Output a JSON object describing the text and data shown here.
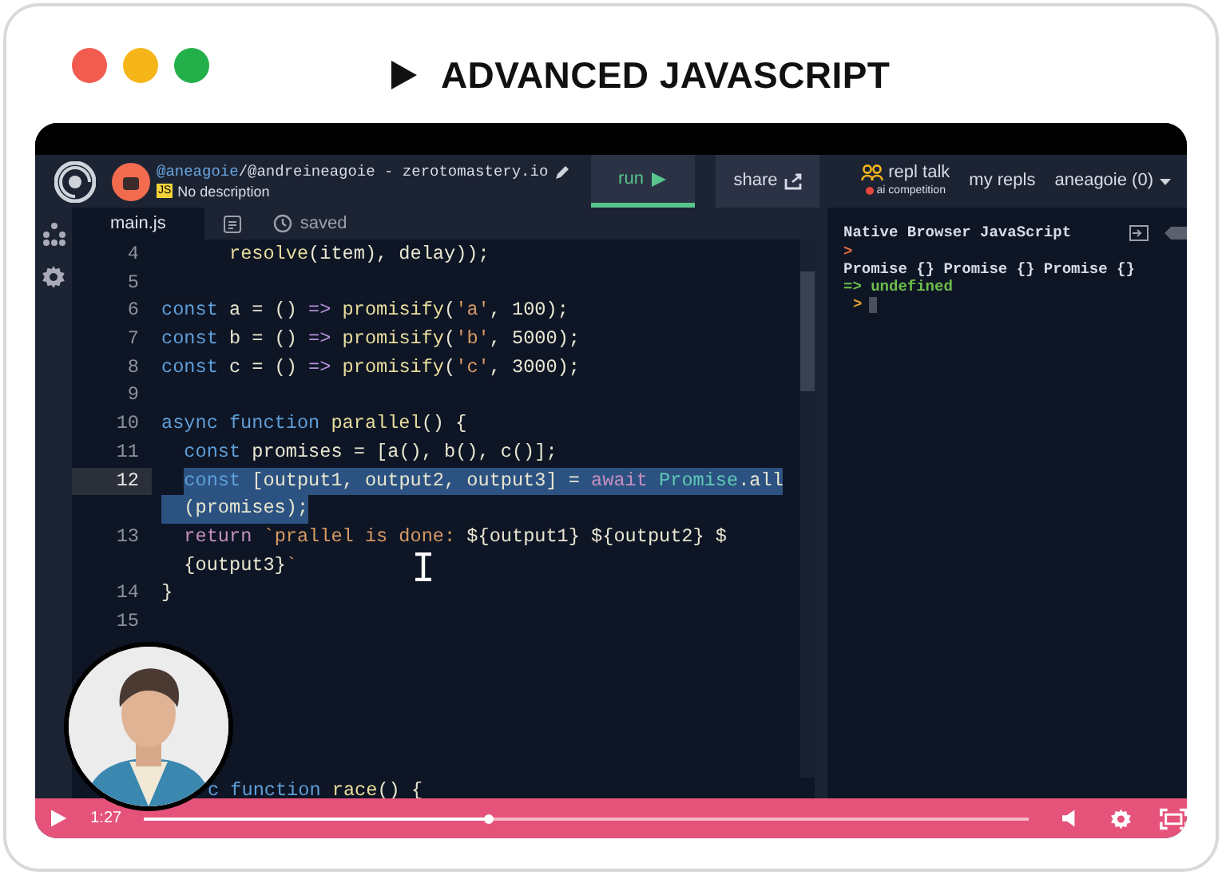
{
  "title": "ADVANCED JAVASCRIPT",
  "repl": {
    "owner": "@aneagoie",
    "name": "/@andreineagoie - zerotomastery.io",
    "badge": "JS",
    "description": "No description",
    "actions": [
      {
        "label": "run",
        "selected": true,
        "kind": "run"
      },
      {
        "label": "share",
        "selected": false,
        "kind": "share"
      }
    ],
    "talk": {
      "label": "repl talk",
      "sub": "ai competition"
    },
    "links": [
      "my repls"
    ],
    "user": "aneagoie (0)"
  },
  "editor": {
    "tab": "main.js",
    "status": "saved",
    "rows": [
      {
        "kind": "code",
        "number": "4",
        "current": false,
        "selected": false,
        "indent": "      ",
        "tokens": [
          {
            "text": "resolve",
            "kind": "func"
          },
          {
            "text": "(item), delay));",
            "kind": "plain"
          }
        ]
      },
      {
        "kind": "code",
        "number": "5",
        "current": false,
        "selected": false,
        "indent": "",
        "tokens": []
      },
      {
        "kind": "code",
        "number": "6",
        "current": false,
        "selected": false,
        "indent": "",
        "tokens": [
          {
            "text": "const",
            "kind": "decl"
          },
          {
            "text": " a = () ",
            "kind": "plain"
          },
          {
            "text": "=>",
            "kind": "operator"
          },
          {
            "text": " promisify",
            "kind": "func"
          },
          {
            "text": "(",
            "kind": "plain"
          },
          {
            "text": "'a'",
            "kind": "string"
          },
          {
            "text": ", 100);",
            "kind": "plain"
          }
        ]
      },
      {
        "kind": "code",
        "number": "7",
        "current": false,
        "selected": false,
        "indent": "",
        "tokens": [
          {
            "text": "const",
            "kind": "decl"
          },
          {
            "text": " b = () ",
            "kind": "plain"
          },
          {
            "text": "=>",
            "kind": "operator"
          },
          {
            "text": " promisify",
            "kind": "func"
          },
          {
            "text": "(",
            "kind": "plain"
          },
          {
            "text": "'b'",
            "kind": "string"
          },
          {
            "text": ", 5000);",
            "kind": "plain"
          }
        ]
      },
      {
        "kind": "code",
        "number": "8",
        "current": false,
        "selected": false,
        "indent": "",
        "tokens": [
          {
            "text": "const",
            "kind": "decl"
          },
          {
            "text": " c = () ",
            "kind": "plain"
          },
          {
            "text": "=>",
            "kind": "operator"
          },
          {
            "text": " promisify",
            "kind": "func"
          },
          {
            "text": "(",
            "kind": "plain"
          },
          {
            "text": "'c'",
            "kind": "string"
          },
          {
            "text": ", 3000);",
            "kind": "plain"
          }
        ]
      },
      {
        "kind": "code",
        "number": "9",
        "current": false,
        "selected": false,
        "indent": "",
        "tokens": []
      },
      {
        "kind": "code",
        "number": "10",
        "current": false,
        "selected": false,
        "indent": "",
        "tokens": [
          {
            "text": "async function",
            "kind": "decl"
          },
          {
            "text": " parallel",
            "kind": "func"
          },
          {
            "text": "() {",
            "kind": "plain"
          }
        ]
      },
      {
        "kind": "code",
        "number": "11",
        "current": false,
        "selected": false,
        "indent": "  ",
        "tokens": [
          {
            "text": "const",
            "kind": "decl"
          },
          {
            "text": " promises = [a(), b(), c()];",
            "kind": "plain"
          }
        ]
      },
      {
        "kind": "code",
        "number": "12",
        "current": true,
        "selected": true,
        "indent": "  ",
        "tokens": [
          {
            "text": "const",
            "kind": "decl"
          },
          {
            "text": " [output1, output2, output3] = ",
            "kind": "plain"
          },
          {
            "text": "await",
            "kind": "control"
          },
          {
            "text": " Promise",
            "kind": "class"
          },
          {
            "text": ".all",
            "kind": "plain"
          }
        ]
      },
      {
        "kind": "code",
        "current": false,
        "selected": true,
        "indent": "",
        "tokens": [
          {
            "text": "  (promises);",
            "kind": "plain"
          }
        ]
      },
      {
        "kind": "code",
        "number": "13",
        "current": false,
        "selected": false,
        "indent": "  ",
        "tokens": [
          {
            "text": "return",
            "kind": "control"
          },
          {
            "text": " `prallel is done: ",
            "kind": "string"
          },
          {
            "text": "${output1} ${output2} $",
            "kind": "plain"
          }
        ]
      },
      {
        "kind": "code",
        "current": false,
        "selected": false,
        "indent": "  ",
        "tokens": [
          {
            "text": "{output3}",
            "kind": "plain"
          },
          {
            "text": "`",
            "kind": "string"
          }
        ]
      },
      {
        "kind": "code",
        "number": "14",
        "current": false,
        "selected": false,
        "indent": "",
        "tokens": [
          {
            "text": "}",
            "kind": "plain"
          }
        ]
      },
      {
        "kind": "code",
        "number": "15",
        "current": false,
        "selected": false,
        "indent": "",
        "tokens": []
      },
      {
        "kind": "code",
        "current": false,
        "selected": false,
        "indent": "",
        "tokens": []
      },
      {
        "kind": "code",
        "current": false,
        "selected": false,
        "indent": "",
        "tokens": []
      },
      {
        "kind": "code",
        "current": false,
        "selected": false,
        "indent": "",
        "tokens": []
      },
      {
        "kind": "code",
        "current": false,
        "selected": false,
        "indent": "",
        "tokens": []
      },
      {
        "kind": "code",
        "current": false,
        "selected": false,
        "indent": "",
        "tokens": []
      },
      {
        "kind": "clipped",
        "current": false,
        "selected": false,
        "indent": "",
        "tokens": [
          {
            "text": "c function",
            "kind": "decl"
          },
          {
            "text": " race",
            "kind": "func"
          },
          {
            "text": "() {",
            "kind": "plain"
          }
        ]
      }
    ]
  },
  "console": {
    "title": "Native Browser JavaScript",
    "lines": [
      {
        "kind": "prompt",
        "text": ">"
      },
      {
        "kind": "output",
        "text": "Promise {} Promise {} Promise {}"
      },
      {
        "kind": "result",
        "text": "=> undefined"
      },
      {
        "kind": "input",
        "text": ">"
      }
    ]
  },
  "player": {
    "time": "1:27",
    "level": 0.39
  }
}
